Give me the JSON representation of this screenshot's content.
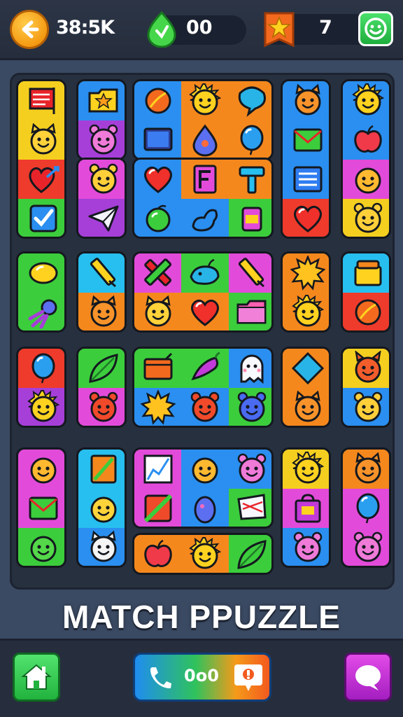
{
  "header": {
    "back_icon": "arrow-left-icon",
    "coins": "38:5K",
    "gem_icon": "green-drop-gem-icon",
    "gems": "00",
    "star_icon": "star-badge-icon",
    "stars": "7",
    "profile_icon": "smiley-face-icon"
  },
  "title": "MATCH PPUZZLE",
  "footer": {
    "home_icon": "home-icon",
    "call_icon": "phone-icon",
    "call_count": "0o0",
    "alert_icon": "alert-badge-icon",
    "chat_icon": "chat-bubble-icon"
  },
  "colors": {
    "yellow": "#f5cf1f",
    "orange": "#f5881d",
    "red": "#ee3b2c",
    "green": "#3ccd3c",
    "blue": "#2a8ff0",
    "cyan": "#27bff0",
    "purple": "#a63fd8",
    "magenta": "#e24bd9",
    "pink": "#ff5fa8"
  },
  "board": {
    "tiles": [
      {
        "name": "tile-c1-r1",
        "cells": [
          {
            "icon": "flag-icon",
            "bg": "#f5cf1f"
          },
          {
            "icon": "cat-face-icon",
            "bg": "#f5cf1f"
          },
          {
            "icon": "heart-arrow-icon",
            "bg": "#ee3b2c"
          },
          {
            "icon": "checkbox-icon",
            "bg": "#3ccd3c"
          }
        ]
      },
      {
        "name": "tile-c2-r1a",
        "cells": [
          {
            "icon": "folder-star-icon",
            "bg": "#2a8ff0"
          },
          {
            "icon": "pig-face-icon",
            "bg": "#a63fd8"
          }
        ]
      },
      {
        "name": "tile-c2-r1b",
        "cells": [
          {
            "icon": "bear-face-icon",
            "bg": "#e24bd9"
          },
          {
            "icon": "paper-plane-icon",
            "bg": "#a63fd8"
          }
        ]
      },
      {
        "name": "tile-c3-r1a",
        "cells": [
          {
            "icon": "ball-icon",
            "bg": "#2a8ff0"
          },
          {
            "icon": "sun-face-icon",
            "bg": "#f5881d"
          },
          {
            "icon": "chat-bubble-icon",
            "bg": "#f5881d"
          },
          {
            "icon": "screen-icon",
            "bg": "#2a8ff0"
          },
          {
            "icon": "drop-icon",
            "bg": "#f5881d"
          },
          {
            "icon": "balloon-icon",
            "bg": "#f5881d"
          }
        ]
      },
      {
        "name": "tile-c3-r1b",
        "cells": [
          {
            "icon": "heart-icon",
            "bg": "#2a8ff0"
          },
          {
            "icon": "flag-f-icon",
            "bg": "#f5881d"
          },
          {
            "icon": "hammer-icon",
            "bg": "#f5881d"
          },
          {
            "icon": "lime-icon",
            "bg": "#2a8ff0"
          },
          {
            "icon": "duck-icon",
            "bg": "#2a8ff0"
          },
          {
            "icon": "jar-icon",
            "bg": "#3ccd3c"
          }
        ]
      },
      {
        "name": "tile-c4-r1",
        "cells": [
          {
            "icon": "tiger-face-icon",
            "bg": "#2a8ff0"
          },
          {
            "icon": "envelope-icon",
            "bg": "#2a8ff0"
          },
          {
            "icon": "list-icon",
            "bg": "#2a8ff0"
          },
          {
            "icon": "heart-icon",
            "bg": "#ee3b2c"
          }
        ]
      },
      {
        "name": "tile-c5-r1",
        "cells": [
          {
            "icon": "sun-face-icon",
            "bg": "#2a8ff0"
          },
          {
            "icon": "apple-icon",
            "bg": "#2a8ff0"
          },
          {
            "icon": "smile-face-icon",
            "bg": "#e24bd9"
          },
          {
            "icon": "bear-face-icon",
            "bg": "#f5cf1f"
          }
        ]
      },
      {
        "name": "tile-c1-r2",
        "cells": [
          {
            "icon": "lemon-icon",
            "bg": "#3ccd3c"
          },
          {
            "icon": "comet-icon",
            "bg": "#3ccd3c"
          }
        ]
      },
      {
        "name": "tile-c2-r2",
        "cells": [
          {
            "icon": "pencil-icon",
            "bg": "#27bff0"
          },
          {
            "icon": "tiger-face-icon",
            "bg": "#f5881d"
          }
        ]
      },
      {
        "name": "tile-c3-r2",
        "cells": [
          {
            "icon": "crossed-pencils-icon",
            "bg": "#e24bd9"
          },
          {
            "icon": "whale-icon",
            "bg": "#3ccd3c"
          },
          {
            "icon": "pencil-icon",
            "bg": "#e24bd9"
          },
          {
            "icon": "cat-face-icon",
            "bg": "#f5881d"
          },
          {
            "icon": "heart-icon",
            "bg": "#f5881d"
          },
          {
            "icon": "folder-icon",
            "bg": "#3ccd3c"
          }
        ]
      },
      {
        "name": "tile-c4-r2",
        "cells": [
          {
            "icon": "sun-icon",
            "bg": "#f5881d"
          },
          {
            "icon": "sun-face-icon",
            "bg": "#f5881d"
          }
        ]
      },
      {
        "name": "tile-c5-r2",
        "cells": [
          {
            "icon": "basket-icon",
            "bg": "#27bff0"
          },
          {
            "icon": "ball-icon",
            "bg": "#ee3b2c"
          }
        ]
      },
      {
        "name": "tile-c1-r3",
        "cells": [
          {
            "icon": "balloon-icon",
            "bg": "#ee3b2c"
          },
          {
            "icon": "sun-face-icon",
            "bg": "#a63fd8"
          }
        ]
      },
      {
        "name": "tile-c2-r3",
        "cells": [
          {
            "icon": "leaf-icon",
            "bg": "#3ccd3c"
          },
          {
            "icon": "tomato-face-icon",
            "bg": "#e24bd9"
          }
        ]
      },
      {
        "name": "tile-c3-r3",
        "cells": [
          {
            "icon": "box-icon",
            "bg": "#3ccd3c"
          },
          {
            "icon": "pepper-icon",
            "bg": "#3ccd3c"
          },
          {
            "icon": "ghost-icon",
            "bg": "#2a8ff0"
          },
          {
            "icon": "sun-icon",
            "bg": "#2a8ff0"
          },
          {
            "icon": "tomato-face-icon",
            "bg": "#2a8ff0"
          },
          {
            "icon": "pepper-icon",
            "bg": "#2a8ff0"
          },
          {
            "icon": "monster-icon",
            "bg": "#3ccd3c"
          }
        ]
      },
      {
        "name": "tile-c4-r3",
        "cells": [
          {
            "icon": "diamond-icon",
            "bg": "#f5881d"
          },
          {
            "icon": "tiger-face-icon",
            "bg": "#f5881d"
          }
        ]
      },
      {
        "name": "tile-c5-r3",
        "cells": [
          {
            "icon": "devil-face-icon",
            "bg": "#f5cf1f"
          },
          {
            "icon": "bear-face-icon",
            "bg": "#2a8ff0"
          }
        ]
      },
      {
        "name": "tile-c1-r4",
        "cells": [
          {
            "icon": "smile-face-icon",
            "bg": "#e24bd9"
          },
          {
            "icon": "envelope-icon",
            "bg": "#e24bd9"
          },
          {
            "icon": "frog-face-icon",
            "bg": "#3ccd3c"
          }
        ]
      },
      {
        "name": "tile-c2-r4",
        "cells": [
          {
            "icon": "notebook-icon",
            "bg": "#27bff0"
          },
          {
            "icon": "chick-icon",
            "bg": "#27bff0"
          },
          {
            "icon": "cat-white-icon",
            "bg": "#2a8ff0"
          }
        ]
      },
      {
        "name": "tile-c3-r4a",
        "cells": [
          {
            "icon": "chart-icon",
            "bg": "#e24bd9"
          },
          {
            "icon": "smile-face-icon",
            "bg": "#2a8ff0"
          },
          {
            "icon": "pig-face-icon",
            "bg": "#2a8ff0"
          },
          {
            "icon": "square-icon",
            "bg": "#e24bd9"
          },
          {
            "icon": "egg-icon",
            "bg": "#2a8ff0"
          },
          {
            "icon": "fan-icon",
            "bg": "#3ccd3c"
          }
        ]
      },
      {
        "name": "tile-c3-r4b",
        "cells": [
          {
            "icon": "apple-icon",
            "bg": "#f5881d"
          },
          {
            "icon": "sun-face-icon",
            "bg": "#f5881d"
          },
          {
            "icon": "leaf-icon",
            "bg": "#3ccd3c"
          }
        ]
      },
      {
        "name": "tile-c4-r4",
        "cells": [
          {
            "icon": "sun-face-icon",
            "bg": "#f5cf1f"
          },
          {
            "icon": "bag-icon",
            "bg": "#e24bd9"
          },
          {
            "icon": "pig-face-icon",
            "bg": "#2a8ff0"
          }
        ]
      },
      {
        "name": "tile-c5-r4",
        "cells": [
          {
            "icon": "tiger-face-icon",
            "bg": "#f5881d"
          },
          {
            "icon": "balloon-icon",
            "bg": "#e24bd9"
          },
          {
            "icon": "pig-face-icon",
            "bg": "#e24bd9"
          }
        ]
      }
    ]
  }
}
